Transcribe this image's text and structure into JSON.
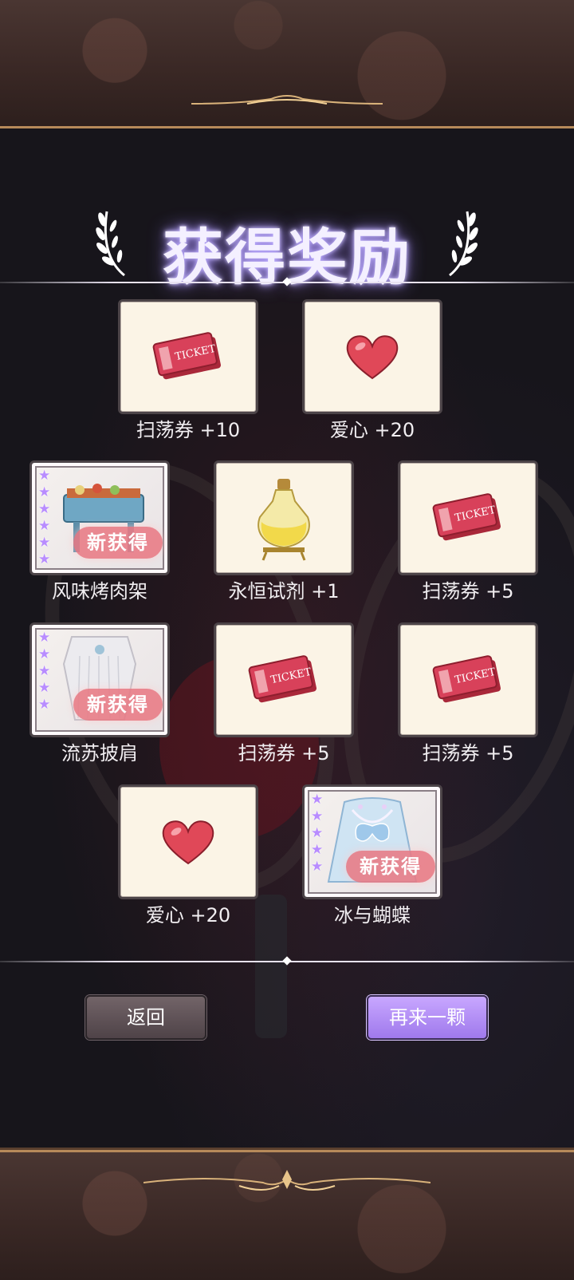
{
  "title": "获得奖励",
  "rewards": [
    {
      "label": "扫荡券 +10",
      "icon": "ticket-icon",
      "new": false
    },
    {
      "label": "爱心 +20",
      "icon": "heart-icon",
      "new": false
    },
    {
      "label": "风味烤肉架",
      "icon": "bbq-grill-icon",
      "new": true,
      "badge": "新获得"
    },
    {
      "label": "永恒试剂 +1",
      "icon": "potion-flask-icon",
      "new": false
    },
    {
      "label": "扫荡券 +5",
      "icon": "ticket-icon",
      "new": false
    },
    {
      "label": "流苏披肩",
      "icon": "tassel-shawl-icon",
      "new": true,
      "badge": "新获得"
    },
    {
      "label": "扫荡券 +5",
      "icon": "ticket-icon",
      "new": false
    },
    {
      "label": "扫荡券 +5",
      "icon": "ticket-icon",
      "new": false
    },
    {
      "label": "爱心 +20",
      "icon": "heart-icon",
      "new": false
    },
    {
      "label": "冰与蝴蝶",
      "icon": "butterfly-dress-icon",
      "new": true,
      "badge": "新获得"
    }
  ],
  "ticket_text": "TICKET",
  "buttons": {
    "back": "返回",
    "again": "再来一颗"
  },
  "colors": {
    "accent": "#a98af5",
    "card": "#fbf4e6",
    "frame_gold": "#b78a5a",
    "new_badge": "#e87a84",
    "star": "#b88cff"
  }
}
